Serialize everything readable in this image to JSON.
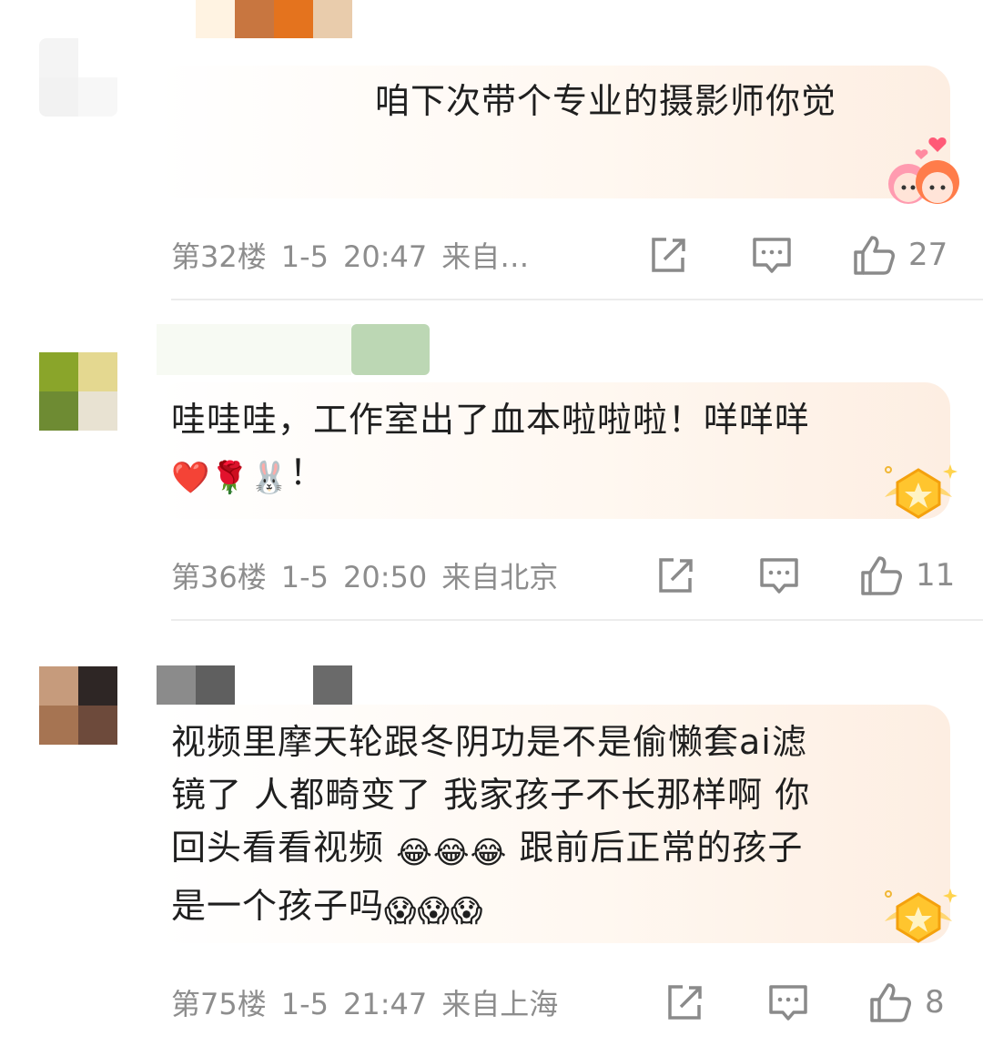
{
  "comments": [
    {
      "text": "咱下次带个专业的摄影师你觉",
      "floor": "第32楼",
      "date": "1-5",
      "time": "20:47",
      "location": "来自…",
      "likes": "27",
      "avatar_colors": [
        "#f4f4f4",
        "#ffffff",
        "#f2f2f2",
        "#f7f7f7"
      ],
      "name_colors": [
        "#fff3e2",
        "#c87640",
        "#e4731e",
        "#e9ccac"
      ]
    },
    {
      "text": "哇哇哇，工作室出了血本啦啦啦！咩咩咩",
      "text2": "！",
      "floor": "第36楼",
      "date": "1-5",
      "time": "20:50",
      "location": "来自北京",
      "likes": "11",
      "avatar_colors": [
        "#8aa52a",
        "#e4d890",
        "#6e8b33",
        "#e8e2d2"
      ],
      "name_colors": [
        "#f4f7ef",
        "#bcd7b4"
      ]
    },
    {
      "text_lines": [
        "视频里摩天轮跟冬阴功是不是偷懒套ai滤",
        "镜了 人都畸变了 我家孩子不长那样啊 你",
        "回头看看视频 ",
        " 跟前后正常的孩子",
        "是一个孩子吗"
      ],
      "floor": "第75楼",
      "date": "1-5",
      "time": "21:47",
      "location": "来自上海",
      "likes": "8",
      "avatar_colors": [
        "#c69b7c",
        "#2e2625",
        "#a67452",
        "#6d4a3b"
      ],
      "name_colors": [
        "#8b8b8b",
        "#5f5f5f",
        "#6a6a6a"
      ]
    }
  ],
  "icons": {
    "share": "share-icon",
    "comment": "comment-icon",
    "like": "thumbs-up-icon",
    "heart": "❤️",
    "rose": "🌹",
    "bunny": "🐰",
    "laugh": "😂",
    "cry": "😱"
  },
  "colors": {
    "meta_text": "#8d8d8d",
    "body_text": "#1f1f1f",
    "bubble_tint": "#fdeee2"
  }
}
